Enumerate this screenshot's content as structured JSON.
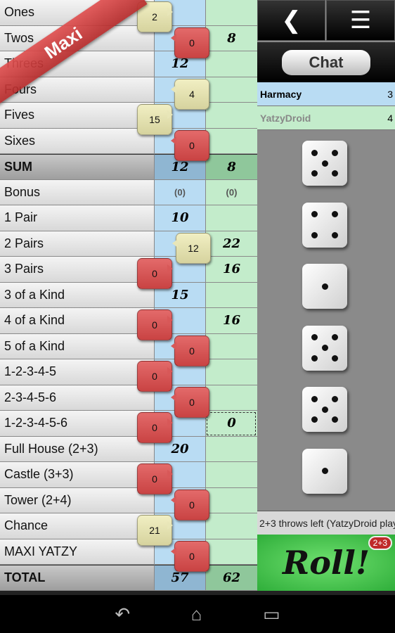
{
  "rows": [
    {
      "label": "Ones",
      "p1": "",
      "p2": ""
    },
    {
      "label": "Twos",
      "p1": "",
      "p2": "8"
    },
    {
      "label": "Threes",
      "p1": "12",
      "p2": ""
    },
    {
      "label": "Fours",
      "p1": "",
      "p2": ""
    },
    {
      "label": "Fives",
      "p1": "",
      "p2": ""
    },
    {
      "label": "Sixes",
      "p1": "",
      "p2": ""
    },
    {
      "label": "SUM",
      "p1": "12",
      "p2": "8"
    },
    {
      "label": "Bonus",
      "p1": "(0)",
      "p2": "(0)"
    },
    {
      "label": "1 Pair",
      "p1": "10",
      "p2": ""
    },
    {
      "label": "2 Pairs",
      "p1": "",
      "p2": "22"
    },
    {
      "label": "3 Pairs",
      "p1": "",
      "p2": "16"
    },
    {
      "label": "3 of a Kind",
      "p1": "15",
      "p2": ""
    },
    {
      "label": "4 of a Kind",
      "p1": "",
      "p2": "16"
    },
    {
      "label": "5 of a Kind",
      "p1": "",
      "p2": ""
    },
    {
      "label": "1-2-3-4-5",
      "p1": "",
      "p2": ""
    },
    {
      "label": "2-3-4-5-6",
      "p1": "",
      "p2": ""
    },
    {
      "label": "1-2-3-4-5-6",
      "p1": "",
      "p2": "0"
    },
    {
      "label": "Full House (2+3)",
      "p1": "20",
      "p2": ""
    },
    {
      "label": "Castle (3+3)",
      "p1": "",
      "p2": ""
    },
    {
      "label": "Tower (2+4)",
      "p1": "",
      "p2": ""
    },
    {
      "label": "Chance",
      "p1": "",
      "p2": ""
    },
    {
      "label": "MAXI YATZY",
      "p1": "",
      "p2": ""
    },
    {
      "label": "TOTAL",
      "p1": "57",
      "p2": "62"
    }
  ],
  "hints": [
    {
      "row": 0,
      "value": "2",
      "kind": "possible"
    },
    {
      "row": 1,
      "value": "0",
      "kind": "zero"
    },
    {
      "row": 3,
      "value": "4",
      "kind": "possible"
    },
    {
      "row": 4,
      "value": "15",
      "kind": "possible"
    },
    {
      "row": 5,
      "value": "0",
      "kind": "zero"
    },
    {
      "row": 9,
      "value": "12",
      "kind": "possible"
    },
    {
      "row": 10,
      "value": "0",
      "kind": "zero"
    },
    {
      "row": 12,
      "value": "0",
      "kind": "zero"
    },
    {
      "row": 13,
      "value": "0",
      "kind": "zero"
    },
    {
      "row": 14,
      "value": "0",
      "kind": "zero"
    },
    {
      "row": 15,
      "value": "0",
      "kind": "zero"
    },
    {
      "row": 16,
      "value": "0",
      "kind": "zero"
    },
    {
      "row": 18,
      "value": "0",
      "kind": "zero"
    },
    {
      "row": 19,
      "value": "0",
      "kind": "zero"
    },
    {
      "row": 20,
      "value": "21",
      "kind": "possible"
    },
    {
      "row": 21,
      "value": "0",
      "kind": "zero"
    }
  ],
  "ribbon": "Maxi",
  "chat_label": "Chat",
  "players": [
    {
      "name": "Harmacy",
      "score": "3"
    },
    {
      "name": "YatzyDroid",
      "score": "4"
    }
  ],
  "dice": [
    5,
    4,
    1,
    5,
    5,
    1
  ],
  "status": "2+3 throws left (YatzyDroid playing)",
  "roll_label": "Roll!",
  "throws_badge": "2+3",
  "icons": {
    "back": "back-arrow-icon",
    "menu": "list-menu-icon"
  },
  "colors": {
    "player1": "#b9dcf3",
    "player2": "#c3eccb",
    "possible": "#e8e6b8",
    "zero": "#d85858"
  }
}
